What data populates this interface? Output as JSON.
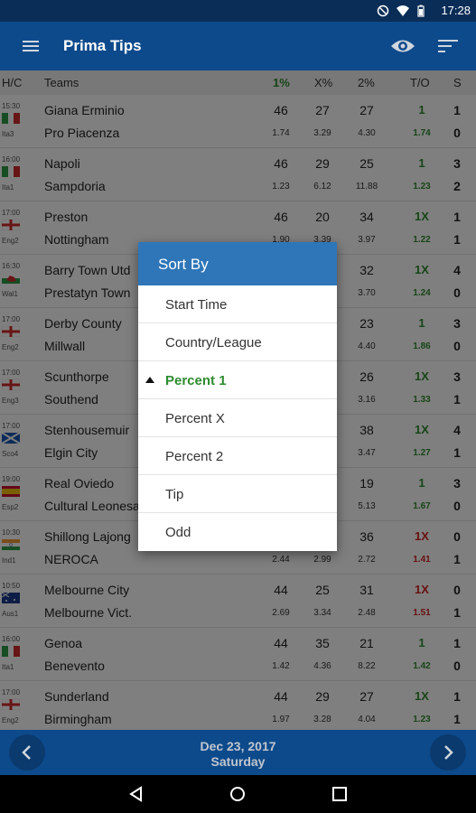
{
  "status_bar": {
    "time": "17:28"
  },
  "app_bar": {
    "title": "Prima Tips",
    "icons": [
      "menu-icon",
      "eye-icon",
      "sort-icon"
    ]
  },
  "table": {
    "headers": {
      "hc": "H/C",
      "teams": "Teams",
      "p1": "1%",
      "px": "X%",
      "p2": "2%",
      "to": "T/O",
      "s": "S"
    },
    "rows": [
      {
        "time": "15:30",
        "league": "Ita3",
        "flag": "italy",
        "home": "Giana Erminio",
        "away": "Pro Piacenza",
        "p1": "46",
        "px": "27",
        "p2": "27",
        "o1": "1.74",
        "ox": "3.29",
        "o2": "4.30",
        "tip": "1",
        "tip_odd": "1.74",
        "tip_color": "green",
        "s1": "1",
        "s2": "0"
      },
      {
        "time": "16:00",
        "league": "Ita1",
        "flag": "italy",
        "home": "Napoli",
        "away": "Sampdoria",
        "p1": "46",
        "px": "29",
        "p2": "25",
        "o1": "1.23",
        "ox": "6.12",
        "o2": "11.88",
        "tip": "1",
        "tip_odd": "1.23",
        "tip_color": "green",
        "s1": "3",
        "s2": "2"
      },
      {
        "time": "17:00",
        "league": "Eng2",
        "flag": "england",
        "home": "Preston",
        "away": "Nottingham",
        "p1": "46",
        "px": "20",
        "p2": "34",
        "o1": "1.90",
        "ox": "3.39",
        "o2": "3.97",
        "tip": "1X",
        "tip_odd": "1.22",
        "tip_color": "green",
        "s1": "1",
        "s2": "1"
      },
      {
        "time": "16:30",
        "league": "Wal1",
        "flag": "wales",
        "home": "Barry Town Utd",
        "away": "Prestatyn Town",
        "p1": "",
        "px": "",
        "p2": "32",
        "o1": "",
        "ox": "",
        "o2": "3.70",
        "tip": "1X",
        "tip_odd": "1.24",
        "tip_color": "green",
        "s1": "4",
        "s2": "0"
      },
      {
        "time": "17:00",
        "league": "Eng2",
        "flag": "england",
        "home": "Derby County",
        "away": "Millwall",
        "p1": "",
        "px": "",
        "p2": "23",
        "o1": "",
        "ox": "",
        "o2": "4.40",
        "tip": "1",
        "tip_odd": "1.86",
        "tip_color": "green",
        "s1": "3",
        "s2": "0"
      },
      {
        "time": "17:00",
        "league": "Eng3",
        "flag": "england",
        "home": "Scunthorpe",
        "away": "Southend",
        "p1": "",
        "px": "",
        "p2": "26",
        "o1": "",
        "ox": "",
        "o2": "3.16",
        "tip": "1X",
        "tip_odd": "1.33",
        "tip_color": "green",
        "s1": "3",
        "s2": "1"
      },
      {
        "time": "17:00",
        "league": "Sco4",
        "flag": "scotland",
        "home": "Stenhousemuir",
        "away": "Elgin City",
        "p1": "",
        "px": "",
        "p2": "38",
        "o1": "",
        "ox": "",
        "o2": "3.47",
        "tip": "1X",
        "tip_odd": "1.27",
        "tip_color": "green",
        "s1": "4",
        "s2": "1"
      },
      {
        "time": "19:00",
        "league": "Esp2",
        "flag": "spain",
        "home": "Real Oviedo",
        "away": "Cultural Leonesa",
        "p1": "",
        "px": "",
        "p2": "19",
        "o1": "",
        "ox": "",
        "o2": "5.13",
        "tip": "1",
        "tip_odd": "1.67",
        "tip_color": "green",
        "s1": "3",
        "s2": "0"
      },
      {
        "time": "10:30",
        "league": "Ind1",
        "flag": "india",
        "home": "Shillong Lajong",
        "away": "NEROCA",
        "p1": "",
        "px": "",
        "p2": "36",
        "o1": "2.44",
        "ox": "2.99",
        "o2": "2.72",
        "tip": "1X",
        "tip_odd": "1.41",
        "tip_color": "red",
        "s1": "0",
        "s2": "1"
      },
      {
        "time": "10:50",
        "league": "Aus1",
        "flag": "australia",
        "home": "Melbourne City",
        "away": "Melbourne Vict.",
        "p1": "44",
        "px": "25",
        "p2": "31",
        "o1": "2.69",
        "ox": "3.34",
        "o2": "2.48",
        "tip": "1X",
        "tip_odd": "1.51",
        "tip_color": "red",
        "s1": "0",
        "s2": "1"
      },
      {
        "time": "16:00",
        "league": "Ita1",
        "flag": "italy",
        "home": "Genoa",
        "away": "Benevento",
        "p1": "44",
        "px": "35",
        "p2": "21",
        "o1": "1.42",
        "ox": "4.36",
        "o2": "8.22",
        "tip": "1",
        "tip_odd": "1.42",
        "tip_color": "green",
        "s1": "1",
        "s2": "0"
      },
      {
        "time": "17:00",
        "league": "Eng2",
        "flag": "england",
        "home": "Sunderland",
        "away": "Birmingham",
        "p1": "44",
        "px": "29",
        "p2": "27",
        "o1": "1.97",
        "ox": "3.28",
        "o2": "4.04",
        "tip": "1X",
        "tip_odd": "1.23",
        "tip_color": "green",
        "s1": "1",
        "s2": "1"
      }
    ]
  },
  "sort_menu": {
    "title": "Sort By",
    "items": [
      {
        "label": "Start Time",
        "active": false
      },
      {
        "label": "Country/League",
        "active": false
      },
      {
        "label": "Percent 1",
        "active": true
      },
      {
        "label": "Percent X",
        "active": false
      },
      {
        "label": "Percent 2",
        "active": false
      },
      {
        "label": "Tip",
        "active": false
      },
      {
        "label": "Odd",
        "active": false
      }
    ]
  },
  "footer": {
    "date": "Dec 23, 2017",
    "day": "Saturday",
    "icons": [
      "prev-arrow-icon",
      "next-arrow-icon"
    ]
  },
  "nav_bar": {
    "icons": [
      "back-icon",
      "home-icon",
      "recents-icon"
    ]
  },
  "colors": {
    "app_bar": "#0d4a8c",
    "menu_header": "#2e76b8",
    "tip_green": "#2e8b2e",
    "tip_red": "#d32020"
  }
}
